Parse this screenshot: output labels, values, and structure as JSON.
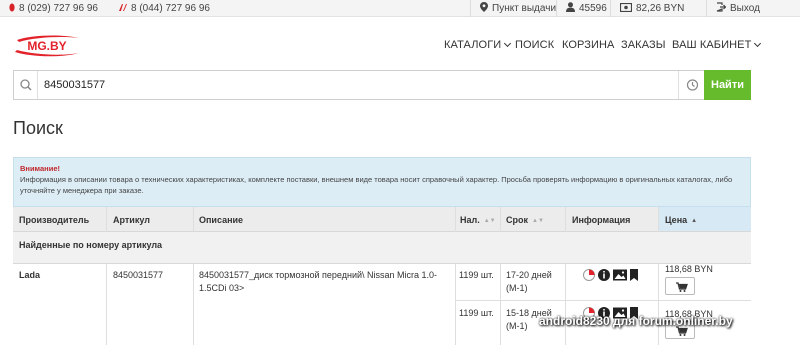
{
  "topbar": {
    "phone1": "8 (029) 727 96 96",
    "phone2": "8 (044) 727 96 96",
    "pickup": "Пункт выдачи",
    "user_id": "45596",
    "balance": "82,26 BYN",
    "logout": "Выход"
  },
  "logo": {
    "text": "MG.BY"
  },
  "nav": {
    "catalogs": "КАТАЛОГИ",
    "search": "ПОИСК",
    "cart": "КОРЗИНА",
    "orders": "ЗАКАЗЫ",
    "account": "ВАШ КАБИНЕТ"
  },
  "search": {
    "value": "8450031577",
    "button": "Найти"
  },
  "page_title": "Поиск",
  "alert": {
    "title": "Внимание!",
    "text": "Информация в описании товара о технических характеристиках, комплекте поставки, внешнем виде товара носит справочный характер. Просьба проверять информацию в оригинальных каталогах, либо уточняйте у менеджера при заказе."
  },
  "table": {
    "headers": {
      "maker": "Производитель",
      "article": "Артикул",
      "description": "Описание",
      "qty": "Нал.",
      "term": "Срок",
      "info": "Информация",
      "price": "Цена"
    },
    "section_label": "Найденные по номеру артикула",
    "group": {
      "maker": "Lada",
      "article": "8450031577",
      "description": "8450031577_диск тормозной передний\\ Nissan Micra 1.0-1.5CDi 03>"
    },
    "offers": [
      {
        "qty": "1199 шт.",
        "term": "17-20 дней",
        "term_note": "(М-1)",
        "price": "118,68 BYN"
      },
      {
        "qty": "1199 шт.",
        "term": "15-18 дней",
        "term_note": "(М-1)",
        "price": "118,68 BYN"
      }
    ]
  },
  "watermark": "android8230 для forum.onliner.by",
  "colors": {
    "accent_red": "#e2232b",
    "button_green": "#66bb2d",
    "alert_bg": "#dcedf6",
    "header_blue": "#d7e9f4"
  }
}
